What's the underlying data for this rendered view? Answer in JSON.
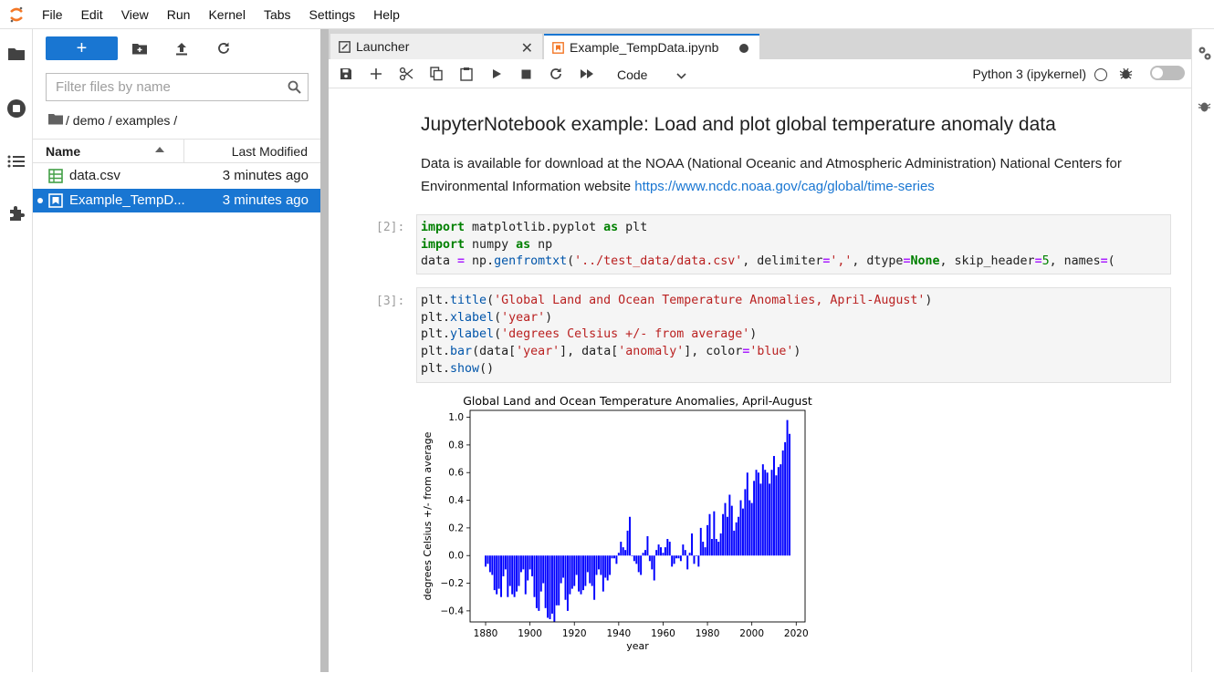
{
  "menubar": {
    "items": [
      "File",
      "Edit",
      "View",
      "Run",
      "Kernel",
      "Tabs",
      "Settings",
      "Help"
    ]
  },
  "filebrowser": {
    "new_label": "+",
    "filter_placeholder": "Filter files by name",
    "breadcrumb": [
      "/ demo / examples /"
    ],
    "columns": {
      "name": "Name",
      "modified": "Last Modified"
    },
    "files": [
      {
        "name": "data.csv",
        "modified": "3 minutes ago",
        "icon": "csv-icon",
        "selected": false
      },
      {
        "name": "Example_TempD...",
        "modified": "3 minutes ago",
        "icon": "notebook-icon",
        "selected": true
      }
    ]
  },
  "tabs": [
    {
      "label": "Launcher",
      "active": false
    },
    {
      "label": "Example_TempData.ipynb",
      "active": true
    }
  ],
  "toolbar": {
    "cell_type": "Code",
    "kernel": "Python 3 (ipykernel)"
  },
  "notebook": {
    "title": "JupyterNotebook example: Load and plot global temperature anomaly data",
    "para_text": "Data is available for download at the NOAA (National Oceanic and Atmospheric Administration) National Centers for Environmental Information website ",
    "para_link": "https://www.ncdc.noaa.gov/cag/global/time-series",
    "cells": [
      {
        "prompt": "[2]:"
      },
      {
        "prompt": "[3]:"
      }
    ]
  },
  "colors": {
    "accent": "#1976d2",
    "bar": "#0000ff"
  },
  "chart_data": {
    "type": "bar",
    "title": "Global Land and Ocean Temperature Anomalies, April-August",
    "xlabel": "year",
    "ylabel": "degrees Celsius +/- from average",
    "xlim": [
      1873,
      2024
    ],
    "ylim": [
      -0.48,
      1.05
    ],
    "xticks": [
      1880,
      1900,
      1920,
      1940,
      1960,
      1980,
      2000,
      2020
    ],
    "yticks": [
      -0.4,
      -0.2,
      0.0,
      0.2,
      0.4,
      0.6,
      0.8,
      1.0
    ],
    "ytick_labels": [
      "−0.4",
      "−0.2",
      "0.0",
      "0.2",
      "0.4",
      "0.6",
      "0.8",
      "1.0"
    ],
    "x": [
      1880,
      1881,
      1882,
      1883,
      1884,
      1885,
      1886,
      1887,
      1888,
      1889,
      1890,
      1891,
      1892,
      1893,
      1894,
      1895,
      1896,
      1897,
      1898,
      1899,
      1900,
      1901,
      1902,
      1903,
      1904,
      1905,
      1906,
      1907,
      1908,
      1909,
      1910,
      1911,
      1912,
      1913,
      1914,
      1915,
      1916,
      1917,
      1918,
      1919,
      1920,
      1921,
      1922,
      1923,
      1924,
      1925,
      1926,
      1927,
      1928,
      1929,
      1930,
      1931,
      1932,
      1933,
      1934,
      1935,
      1936,
      1937,
      1938,
      1939,
      1940,
      1941,
      1942,
      1943,
      1944,
      1945,
      1946,
      1947,
      1948,
      1949,
      1950,
      1951,
      1952,
      1953,
      1954,
      1955,
      1956,
      1957,
      1958,
      1959,
      1960,
      1961,
      1962,
      1963,
      1964,
      1965,
      1966,
      1967,
      1968,
      1969,
      1970,
      1971,
      1972,
      1973,
      1974,
      1975,
      1976,
      1977,
      1978,
      1979,
      1980,
      1981,
      1982,
      1983,
      1984,
      1985,
      1986,
      1987,
      1988,
      1989,
      1990,
      1991,
      1992,
      1993,
      1994,
      1995,
      1996,
      1997,
      1998,
      1999,
      2000,
      2001,
      2002,
      2003,
      2004,
      2005,
      2006,
      2007,
      2008,
      2009,
      2010,
      2011,
      2012,
      2013,
      2014,
      2015,
      2016,
      2017
    ],
    "values": [
      -0.08,
      -0.06,
      -0.12,
      -0.14,
      -0.25,
      -0.28,
      -0.24,
      -0.3,
      -0.15,
      -0.1,
      -0.3,
      -0.22,
      -0.28,
      -0.3,
      -0.26,
      -0.22,
      -0.12,
      -0.1,
      -0.28,
      -0.18,
      -0.1,
      -0.15,
      -0.3,
      -0.38,
      -0.4,
      -0.26,
      -0.2,
      -0.38,
      -0.45,
      -0.46,
      -0.42,
      -0.48,
      -0.36,
      -0.36,
      -0.2,
      -0.16,
      -0.32,
      -0.4,
      -0.28,
      -0.24,
      -0.22,
      -0.14,
      -0.26,
      -0.28,
      -0.25,
      -0.22,
      -0.12,
      -0.2,
      -0.22,
      -0.32,
      -0.14,
      -0.1,
      -0.14,
      -0.26,
      -0.16,
      -0.18,
      -0.14,
      -0.02,
      -0.02,
      -0.06,
      0.02,
      0.1,
      0.06,
      0.04,
      0.18,
      0.28,
      0.0,
      -0.04,
      -0.06,
      -0.12,
      -0.14,
      0.02,
      0.04,
      0.14,
      -0.04,
      -0.1,
      -0.18,
      0.04,
      0.08,
      0.06,
      0.02,
      0.06,
      0.12,
      0.1,
      -0.08,
      -0.06,
      -0.02,
      -0.02,
      -0.04,
      0.08,
      0.04,
      -0.1,
      0.02,
      0.16,
      -0.06,
      0.0,
      -0.08,
      0.2,
      0.1,
      0.06,
      0.22,
      0.3,
      0.12,
      0.32,
      0.12,
      0.1,
      0.16,
      0.3,
      0.38,
      0.28,
      0.44,
      0.36,
      0.18,
      0.24,
      0.28,
      0.4,
      0.34,
      0.48,
      0.6,
      0.4,
      0.38,
      0.54,
      0.62,
      0.6,
      0.52,
      0.66,
      0.62,
      0.6,
      0.52,
      0.62,
      0.72,
      0.58,
      0.64,
      0.66,
      0.76,
      0.82,
      0.98,
      0.88
    ]
  }
}
